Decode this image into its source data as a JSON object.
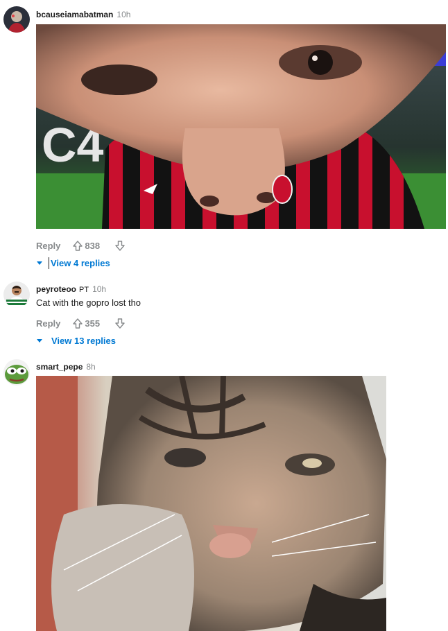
{
  "comments": [
    {
      "username": "bcauseiamabatman",
      "time": "10h",
      "media_alt": "Meme image: close-up face wearing a red and black striped AC Milan Puma jersey",
      "reply_label": "Reply",
      "upvotes": "838",
      "view_replies": "View 4 replies"
    },
    {
      "username": "peyroteoo",
      "flair": "PT",
      "time": "10h",
      "text": "Cat with the gopro lost tho",
      "reply_label": "Reply",
      "upvotes": "355",
      "view_replies": "View 13 replies"
    },
    {
      "username": "smart_pepe",
      "time": "8h",
      "media_alt": "Meme image: close-up of a tabby cat carrying a kitten in its mouth"
    }
  ],
  "colors": {
    "link_blue": "#0079d3",
    "meta_gray": "#878a8c",
    "text": "#1c1c1c"
  },
  "icons": [
    "upvote-arrow-icon",
    "downvote-arrow-icon",
    "caret-down-icon"
  ]
}
